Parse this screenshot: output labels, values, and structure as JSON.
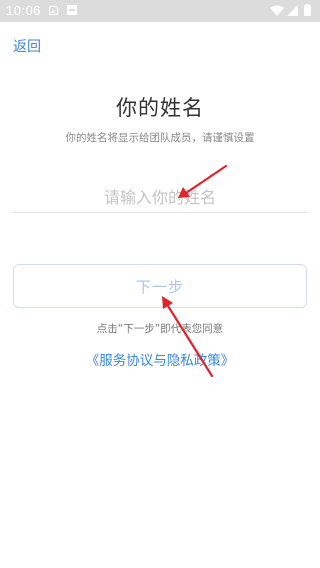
{
  "status_bar": {
    "time": "10:06",
    "icons": [
      "image-icon",
      "notification-box-icon",
      "wifi-icon",
      "signal-icon",
      "battery-icon"
    ]
  },
  "nav": {
    "back_label": "返回"
  },
  "main": {
    "title": "你的姓名",
    "subtitle": "你的姓名将显示给团队成员，请谨慎设置",
    "name_placeholder": "请输入你的姓名",
    "next_label": "下一步",
    "consent_text": "点击“下一步”即代表您同意",
    "policy_link": "《服务协议与隐私政策》"
  },
  "annotations": {
    "arrow_color": "#e0242a"
  },
  "colors": {
    "accent": "#3d86d8",
    "status_bar_bg": "#dcdcdc",
    "button_text_disabled": "#a7c7ec"
  }
}
